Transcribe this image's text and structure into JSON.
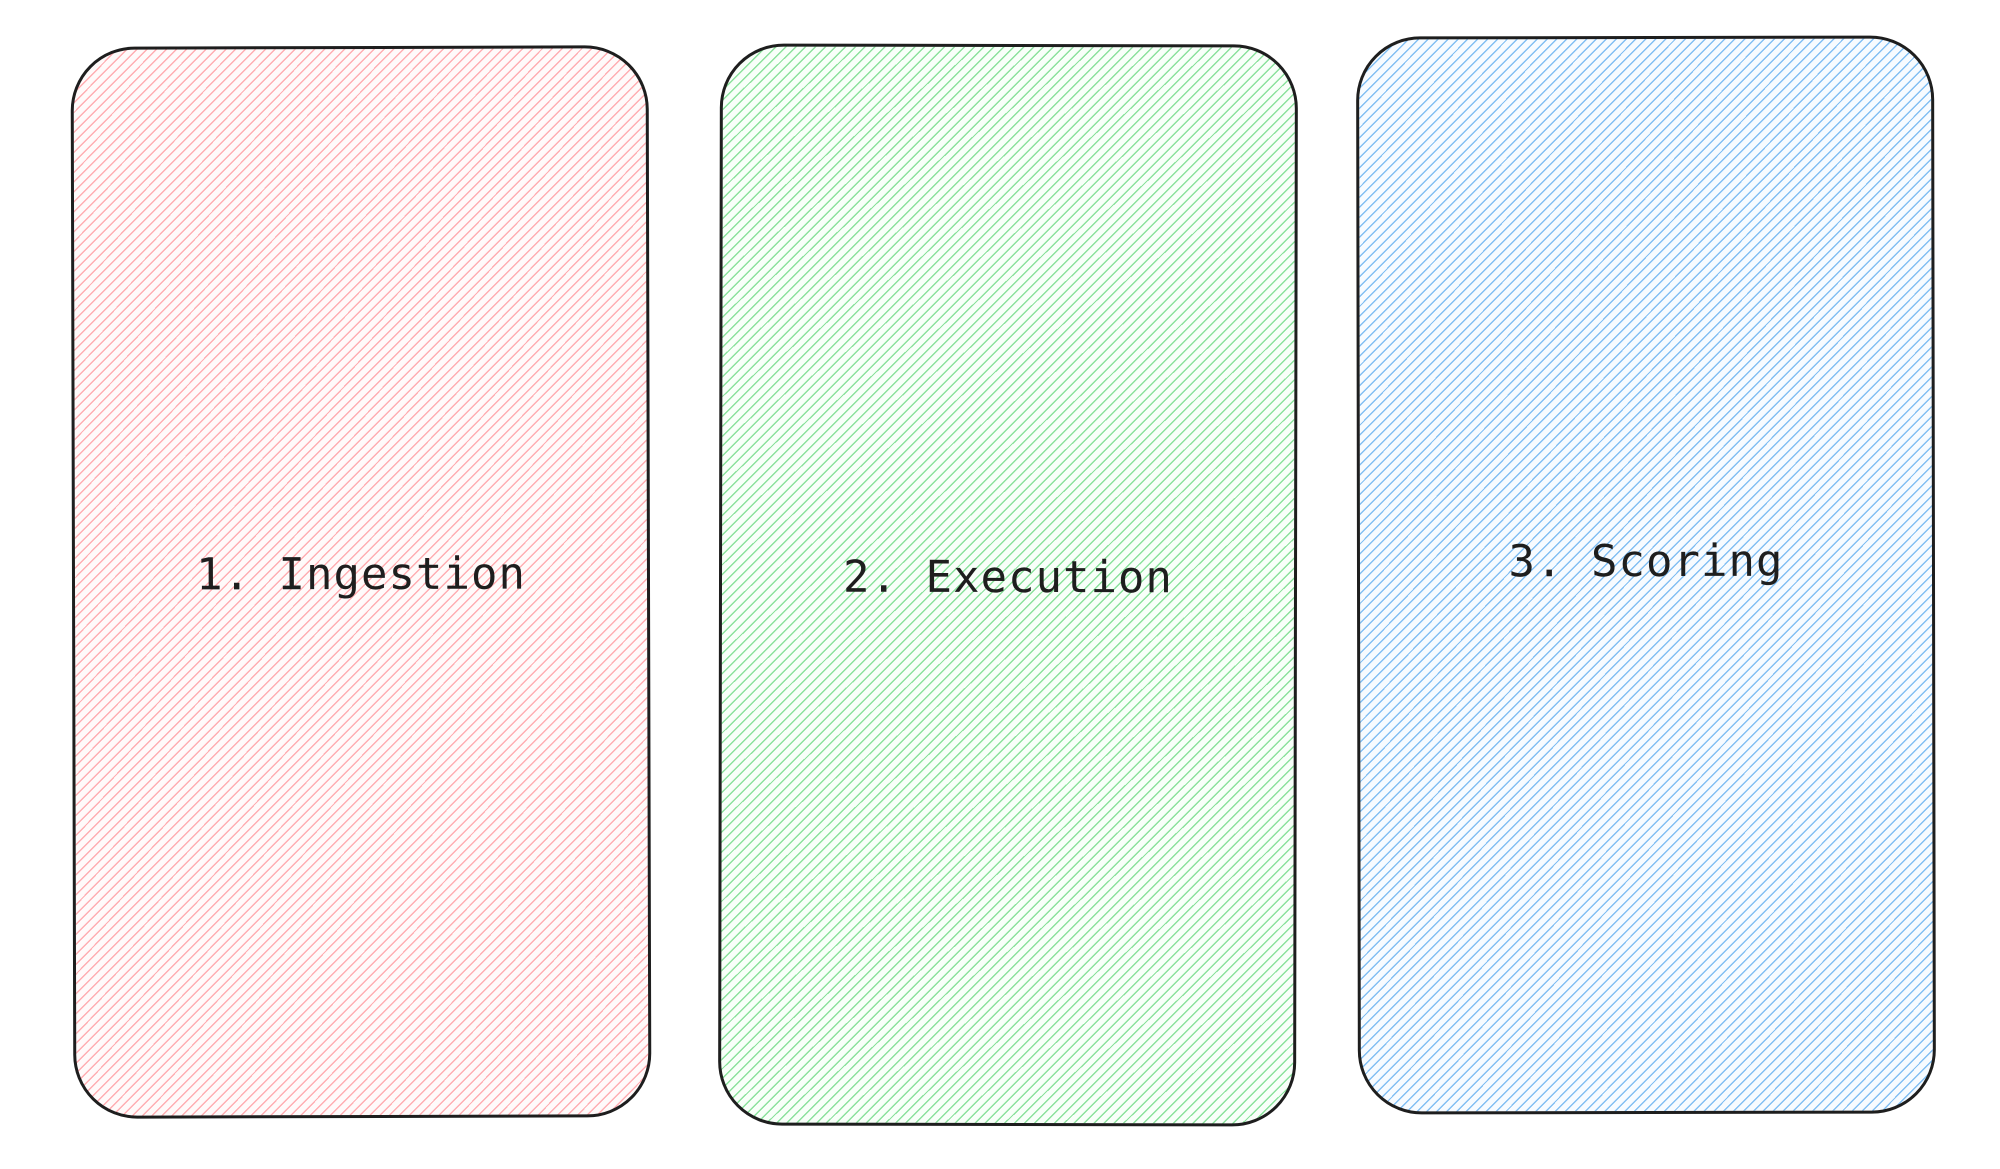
{
  "diagram": {
    "cards": [
      {
        "label": "1. Ingestion",
        "color": "#ffa0a5"
      },
      {
        "label": "2. Execution",
        "color": "#78dc8c"
      },
      {
        "label": "3. Scoring",
        "color": "#6eb4f0"
      }
    ],
    "stroke_color": "#1e1e1e"
  }
}
